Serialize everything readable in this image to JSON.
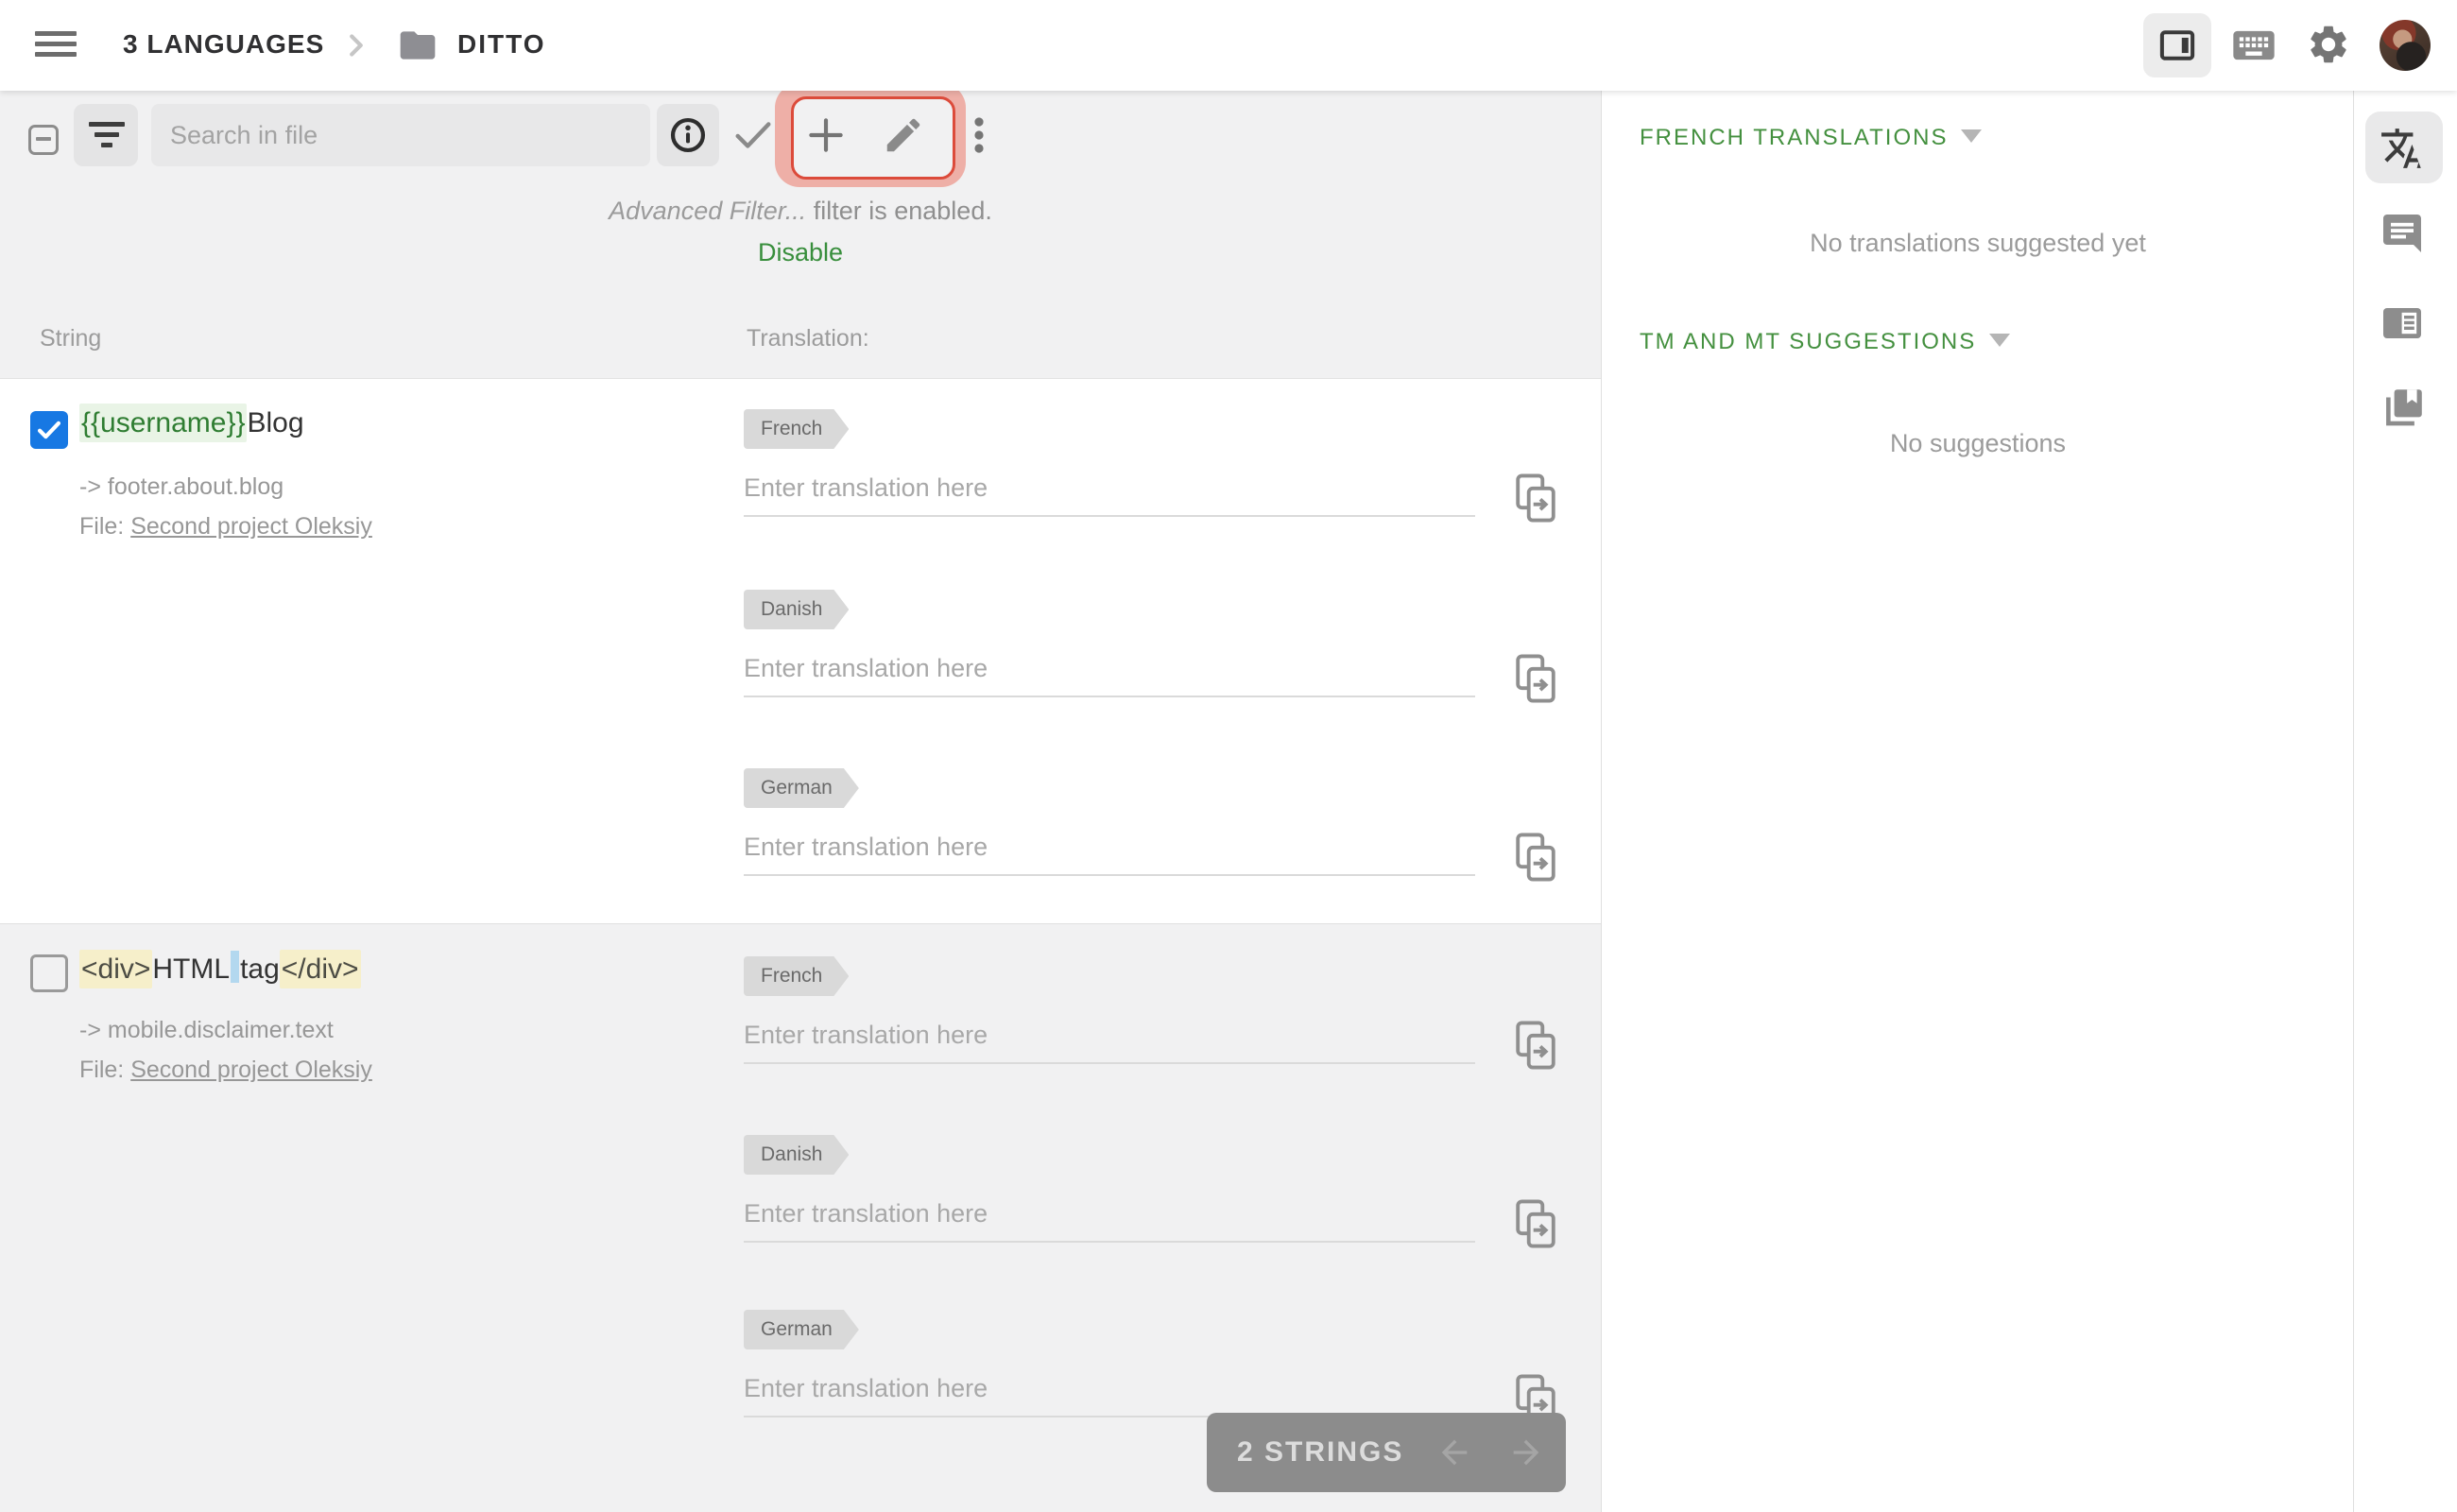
{
  "header": {
    "breadcrumb_root": "3 LANGUAGES",
    "breadcrumb_current": "DITTO"
  },
  "toolbar": {
    "search_placeholder": "Search in file"
  },
  "filter_notice": {
    "filter_name": "Advanced Filter...",
    "message": " filter is enabled.",
    "action_label": "Disable"
  },
  "table": {
    "string_header": "String",
    "translation_header": "Translation:"
  },
  "rows": [
    {
      "checked": true,
      "string_parts": [
        {
          "text": "{{username}}",
          "kind": "placeholder"
        },
        {
          "text": "Blog",
          "kind": "plain"
        }
      ],
      "key_path": "-> footer.about.blog",
      "file_label": "File:",
      "file_link": "Second project Oleksiy",
      "translations": [
        {
          "language": "French",
          "value": "",
          "placeholder": "Enter translation here"
        },
        {
          "language": "Danish",
          "value": "",
          "placeholder": "Enter translation here"
        },
        {
          "language": "German",
          "value": "",
          "placeholder": "Enter translation here"
        }
      ]
    },
    {
      "checked": false,
      "string_parts": [
        {
          "text": "<div>",
          "kind": "html-tag"
        },
        {
          "text": "HTML",
          "kind": "plain"
        },
        {
          "text": " ",
          "kind": "whitespace"
        },
        {
          "text": "tag",
          "kind": "plain"
        },
        {
          "text": "</div>",
          "kind": "html-tag"
        }
      ],
      "key_path": "-> mobile.disclaimer.text",
      "file_label": "File:",
      "file_link": "Second project Oleksiy",
      "translations": [
        {
          "language": "French",
          "value": "",
          "placeholder": "Enter translation here"
        },
        {
          "language": "Danish",
          "value": "",
          "placeholder": "Enter translation here"
        },
        {
          "language": "German",
          "value": "",
          "placeholder": "Enter translation here"
        }
      ]
    }
  ],
  "footer": {
    "strings_count": "2 STRINGS"
  },
  "right_panel": {
    "sections": [
      {
        "title": "FRENCH TRANSLATIONS",
        "empty_message": "No translations suggested yet"
      },
      {
        "title": "TM AND MT SUGGESTIONS",
        "empty_message": "No suggestions"
      }
    ]
  },
  "colors": {
    "accent_green": "#388e3c",
    "checkbox_blue": "#1778e3",
    "tutorial_highlight_red": "#dc4b3b",
    "tutorial_highlight_pink": "#eeafa7",
    "language_tag_gray": "#d9d9d9",
    "string_placeholder_green_bg": "#e9f4e6",
    "html_tag_yellow_bg": "#f6efca",
    "whitespace_blue": "#b3d8ef"
  }
}
